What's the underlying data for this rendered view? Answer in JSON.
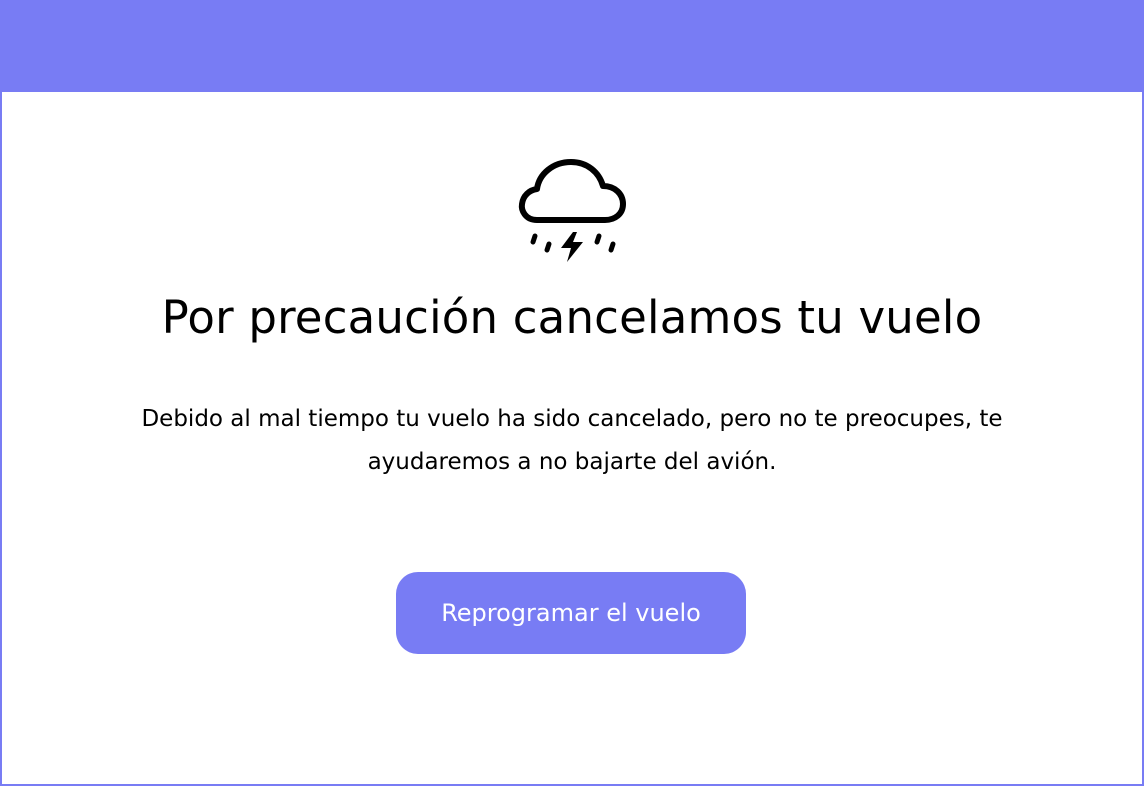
{
  "header": {
    "color": "#787cf4"
  },
  "notice": {
    "icon": "storm-cloud-lightning-icon",
    "title": "Por precaución cancelamos tu vuelo",
    "message": "Debido al mal tiempo tu vuelo ha sido cancelado, pero no te preocupes, te ayudaremos a no bajarte del avión.",
    "button_label": "Reprogramar el vuelo"
  }
}
